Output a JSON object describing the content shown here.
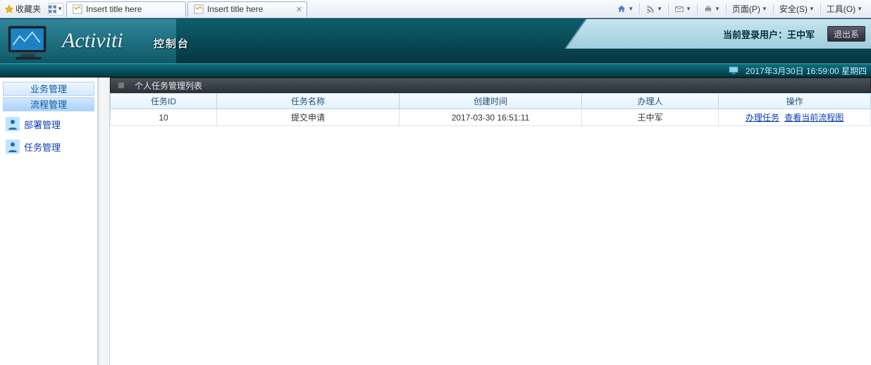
{
  "browser": {
    "favorites": "收藏夹",
    "tabs": [
      {
        "title": "Insert title here",
        "active": false
      },
      {
        "title": "Insert title here",
        "active": true
      }
    ],
    "tools": {
      "page": "页面(P)",
      "safety": "安全(S)",
      "tools_menu": "工具(O)"
    }
  },
  "header": {
    "brand": "Activiti",
    "subtitle": "控制台",
    "login_label": "当前登录用户：王中军",
    "logout": "退出系"
  },
  "status": {
    "datetime": "2017年3月30日 16:59:00 星期四"
  },
  "sidebar": {
    "groups": [
      {
        "label": "业务管理",
        "active": false
      },
      {
        "label": "流程管理",
        "active": true
      }
    ],
    "items": [
      {
        "label": "部署管理"
      },
      {
        "label": "任务管理"
      }
    ]
  },
  "section": {
    "title": "个人任务管理列表"
  },
  "table": {
    "headers": {
      "id": "任务ID",
      "name": "任务名称",
      "created": "创建时间",
      "assignee": "办理人",
      "ops": "操作"
    },
    "rows": [
      {
        "id": "10",
        "name": "提交申请",
        "created": "2017-03-30 16:51:11",
        "assignee": "王中军",
        "op_handle": "办理任务",
        "op_view": "查看当前流程图"
      }
    ]
  }
}
